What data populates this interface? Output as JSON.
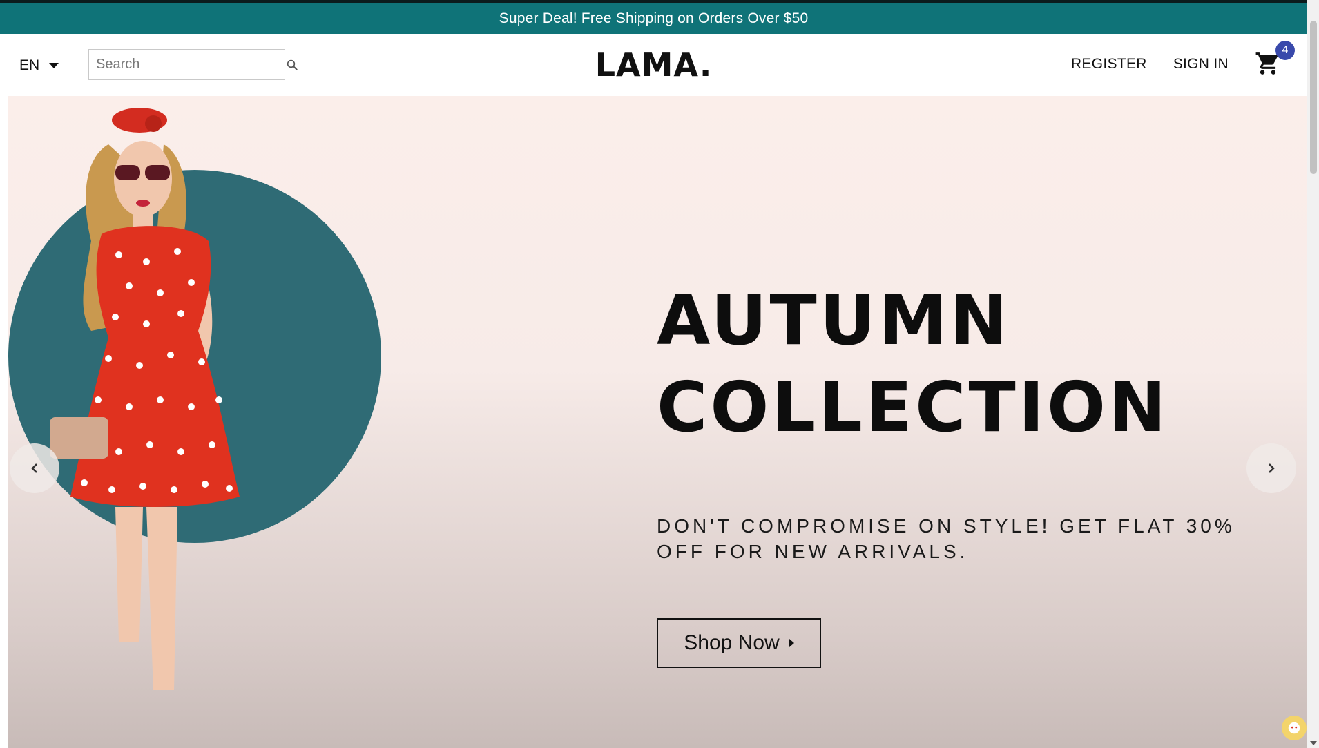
{
  "announcement": {
    "text": "Super Deal! Free Shipping on Orders Over $50"
  },
  "navbar": {
    "language": "EN",
    "search": {
      "placeholder": "Search",
      "icon": "search-icon"
    },
    "logo": "LAMA.",
    "links": {
      "register": "REGISTER",
      "sign_in": "SIGN IN"
    },
    "cart": {
      "icon": "shopping-cart-icon",
      "count": "4",
      "badge_color": "#3949ab"
    }
  },
  "hero": {
    "title_line1": "AUTUMN",
    "title_line2": "COLLECTION",
    "description": "DON'T COMPROMISE ON STYLE! GET FLAT 30% OFF FOR NEW ARRIVALS.",
    "cta_label": "Shop Now",
    "left_arrow_icon": "arrow-left-icon",
    "right_arrow_icon": "arrow-right-icon",
    "accent_circle_color": "#2f6b75",
    "background_color": "#fbeeea"
  },
  "colors": {
    "announcement_bg": "#0f7378",
    "announcement_text": "#ffffff"
  }
}
